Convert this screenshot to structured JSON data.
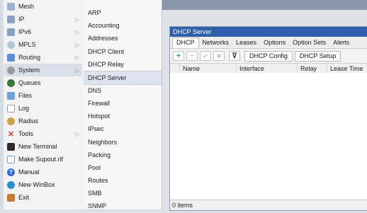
{
  "sidebar": {
    "items": [
      {
        "label": "Mesh",
        "icon": "mesh-icon",
        "submenu": false
      },
      {
        "label": "IP",
        "icon": "ip-icon",
        "submenu": true
      },
      {
        "label": "IPv6",
        "icon": "ipv6-icon",
        "submenu": true
      },
      {
        "label": "MPLS",
        "icon": "mpls-icon",
        "submenu": true
      },
      {
        "label": "Routing",
        "icon": "routing-icon",
        "submenu": true
      },
      {
        "label": "System",
        "icon": "system-icon",
        "submenu": true
      },
      {
        "label": "Queues",
        "icon": "queues-icon",
        "submenu": false
      },
      {
        "label": "Files",
        "icon": "files-icon",
        "submenu": false
      },
      {
        "label": "Log",
        "icon": "log-icon",
        "submenu": false
      },
      {
        "label": "Radius",
        "icon": "radius-icon",
        "submenu": false
      },
      {
        "label": "Tools",
        "icon": "tools-icon",
        "submenu": true
      },
      {
        "label": "New Terminal",
        "icon": "terminal-icon",
        "submenu": false
      },
      {
        "label": "Make Supout.rif",
        "icon": "supout-icon",
        "submenu": false
      },
      {
        "label": "Manual",
        "icon": "manual-icon",
        "submenu": false
      },
      {
        "label": "New WinBox",
        "icon": "winbox-icon",
        "submenu": false
      },
      {
        "label": "Exit",
        "icon": "exit-icon",
        "submenu": false
      }
    ],
    "submenu_arrow": "▷"
  },
  "submenu": {
    "items": [
      "ARP",
      "Accounting",
      "Addresses",
      "DHCP Client",
      "DHCP Relay",
      "DHCP Server",
      "DNS",
      "Firewall",
      "Hotspot",
      "IPsec",
      "Neighbors",
      "Packing",
      "Pool",
      "Routes",
      "SMB",
      "SNMP"
    ],
    "active": "DHCP Server"
  },
  "window": {
    "title": "DHCP Server",
    "tabs": [
      "DHCP",
      "Networks",
      "Leases",
      "Options",
      "Option Sets",
      "Alerts"
    ],
    "active_tab": "DHCP",
    "toolbar": {
      "add_symbol": "+",
      "remove_symbol": "−",
      "enable_symbol": "✔",
      "disable_symbol": "✖",
      "filter_symbol": "⊽",
      "config_label": "DHCP Config",
      "setup_label": "DHCP Setup"
    },
    "columns": [
      "Name",
      "Interface",
      "Relay",
      "Lease Time"
    ],
    "status": "0 items"
  },
  "colors": {
    "title_bar": "#2e5fa8",
    "accent_green": "#2a9a3a",
    "accent_blue": "#3b6fc6"
  }
}
